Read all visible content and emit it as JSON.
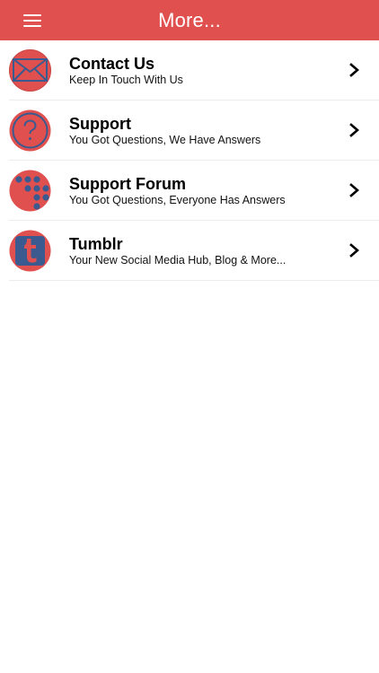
{
  "header": {
    "title": "More...",
    "menu_icon": "hamburger-menu-icon",
    "background_color": "#e0504f"
  },
  "list": {
    "items": [
      {
        "title": "Contact Us",
        "subtitle": "Keep In Touch With Us",
        "icon": "envelope-icon"
      },
      {
        "title": "Support",
        "subtitle": "You Got Questions, We Have Answers",
        "icon": "question-mark-icon"
      },
      {
        "title": "Support Forum",
        "subtitle": "You Got Questions, Everyone Has Answers",
        "icon": "dots-grid-icon"
      },
      {
        "title": "Tumblr",
        "subtitle": "Your New Social Media Hub, Blog & More...",
        "icon": "tumblr-icon"
      }
    ],
    "chevron_icon": "chevron-right-icon"
  },
  "colors": {
    "accent_red": "#e0504f",
    "icon_blue": "#3b5a8f"
  }
}
